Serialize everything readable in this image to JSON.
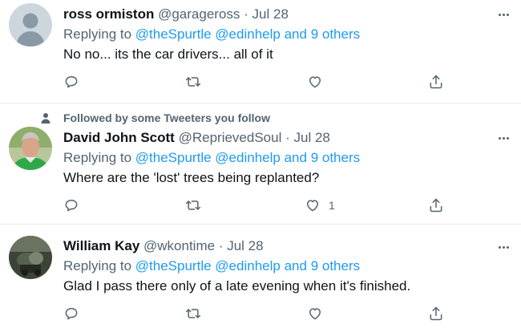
{
  "tweets": [
    {
      "name": "ross ormiston",
      "handle": "@garageross",
      "dot": "·",
      "date": "Jul 28",
      "replying_prefix": "Replying to",
      "mention1": "@theSpurtle",
      "mention2": "@edinhelp",
      "and_text": "and",
      "others": "9 others",
      "text": "No no... its the car drivers... all of it",
      "like_count": ""
    },
    {
      "social_context": "Followed by some Tweeters you follow",
      "name": "David John Scott",
      "handle": "@ReprievedSoul",
      "dot": "·",
      "date": "Jul 28",
      "replying_prefix": "Replying to",
      "mention1": "@theSpurtle",
      "mention2": "@edinhelp",
      "and_text": "and",
      "others": "9 others",
      "text": "Where are the 'lost' trees being replanted?",
      "like_count": "1"
    },
    {
      "name": "William Kay",
      "handle": "@wkontime",
      "dot": "·",
      "date": "Jul 28",
      "replying_prefix": "Replying to",
      "mention1": "@theSpurtle",
      "mention2": "@edinhelp",
      "and_text": "and",
      "others": "9 others",
      "text": "Glad I pass there only of a late evening when it's finished.",
      "like_count": ""
    }
  ],
  "icons": {
    "reply": "reply-icon",
    "retweet": "retweet-icon",
    "like": "heart-icon",
    "share": "share-icon",
    "more": "more-icon",
    "person": "person-icon"
  },
  "colors": {
    "accent": "#1d9bf0",
    "secondary_text": "#536471",
    "primary_text": "#0f1419",
    "divider": "#e6ecf0"
  }
}
